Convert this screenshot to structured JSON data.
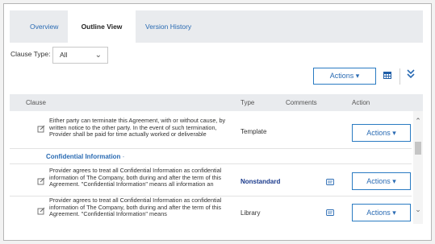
{
  "tabs": [
    {
      "label": "Overview"
    },
    {
      "label": "Outline View"
    },
    {
      "label": "Version History"
    }
  ],
  "filter": {
    "label": "Clause Type:",
    "value": "All"
  },
  "toolbar": {
    "actions_label": "Actions ▾"
  },
  "table": {
    "headers": {
      "clause": "Clause",
      "type": "Type",
      "comments": "Comments",
      "action": "Action"
    },
    "rows": [
      {
        "text": "Either party can terminate this Agreement, with or without cause, by written notice to the other party. In the event of such termination, Provider shall be paid for time actually worked or deliverable",
        "type": "Template",
        "action": "Actions ▾"
      },
      {
        "text": "Provider agrees to treat all Confidential Information as confidential information of The Company, both during and after the term of this Agreement. \"Confidential Information\" means all information an",
        "type": "Nonstandard",
        "action": "Actions ▾"
      },
      {
        "text": "Provider agrees to treat all Confidential Information as confidential information of The Company, both during and after the term of this Agreement. \"Confidential Information\" means",
        "type": "Library",
        "action": "Actions ▾"
      }
    ],
    "section": {
      "title": "Confidential Information",
      "caret": "-"
    }
  },
  "colors": {
    "accent": "#2a6bb3",
    "nonstandard": "#1a3a8c",
    "header_bg": "#e9ebee"
  }
}
